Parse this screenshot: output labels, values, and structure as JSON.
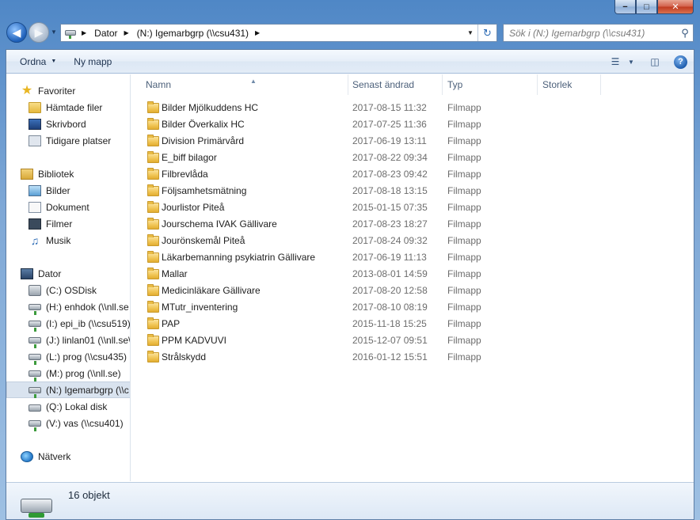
{
  "window": {
    "caption_min": "−",
    "caption_max": "□",
    "caption_close": "✕"
  },
  "address": {
    "crumbs": [
      "Dator",
      "(N:) Igemarbgrp (\\\\csu431)"
    ],
    "search_placeholder": "Sök i (N:) Igemarbgrp (\\\\csu431)"
  },
  "toolbar": {
    "organize_label": "Ordna",
    "new_folder_label": "Ny mapp"
  },
  "nav": {
    "favorites_label": "Favoriter",
    "favorites": [
      "Hämtade filer",
      "Skrivbord",
      "Tidigare platser"
    ],
    "libraries_label": "Bibliotek",
    "libraries": [
      "Bilder",
      "Dokument",
      "Filmer",
      "Musik"
    ],
    "computer_label": "Dator",
    "drives": [
      "(C:) OSDisk",
      "(H:) enhdok (\\\\nll.se",
      "(I:) epi_ib (\\\\csu519)",
      "(J:) linlan01 (\\\\nll.se\\",
      "(L:) prog (\\\\csu435)",
      "(M:) prog (\\\\nll.se)",
      "(N:) Igemarbgrp (\\\\c",
      "(Q:) Lokal disk",
      "(V:) vas (\\\\csu401)"
    ],
    "network_label": "Nätverk"
  },
  "columns": {
    "name": "Namn",
    "modified": "Senast ändrad",
    "type": "Typ",
    "size": "Storlek"
  },
  "files": [
    {
      "name": "Bilder Mjölkuddens HC",
      "modified": "2017-08-15 11:32",
      "type": "Filmapp"
    },
    {
      "name": "Bilder Överkalix HC",
      "modified": "2017-07-25 11:36",
      "type": "Filmapp"
    },
    {
      "name": "Division Primärvård",
      "modified": "2017-06-19 13:11",
      "type": "Filmapp"
    },
    {
      "name": "E_biff bilagor",
      "modified": "2017-08-22 09:34",
      "type": "Filmapp"
    },
    {
      "name": "Filbrevlåda",
      "modified": "2017-08-23 09:42",
      "type": "Filmapp"
    },
    {
      "name": "Följsamhetsmätning",
      "modified": "2017-08-18 13:15",
      "type": "Filmapp"
    },
    {
      "name": "Jourlistor Piteå",
      "modified": "2015-01-15 07:35",
      "type": "Filmapp"
    },
    {
      "name": "Jourschema IVAK Gällivare",
      "modified": "2017-08-23 18:27",
      "type": "Filmapp"
    },
    {
      "name": "Jourönskemål Piteå",
      "modified": "2017-08-24 09:32",
      "type": "Filmapp"
    },
    {
      "name": "Läkarbemanning psykiatrin Gällivare",
      "modified": "2017-06-19 11:13",
      "type": "Filmapp"
    },
    {
      "name": "Mallar",
      "modified": "2013-08-01 14:59",
      "type": "Filmapp"
    },
    {
      "name": "Medicinläkare Gällivare",
      "modified": "2017-08-20 12:58",
      "type": "Filmapp"
    },
    {
      "name": "MTutr_inventering",
      "modified": "2017-08-10 08:19",
      "type": "Filmapp"
    },
    {
      "name": "PAP",
      "modified": "2015-11-18 15:25",
      "type": "Filmapp"
    },
    {
      "name": "PPM KADVUVI",
      "modified": "2015-12-07 09:51",
      "type": "Filmapp"
    },
    {
      "name": "Strålskydd",
      "modified": "2016-01-12 15:51",
      "type": "Filmapp"
    }
  ],
  "status": {
    "count_text": "16 objekt"
  }
}
